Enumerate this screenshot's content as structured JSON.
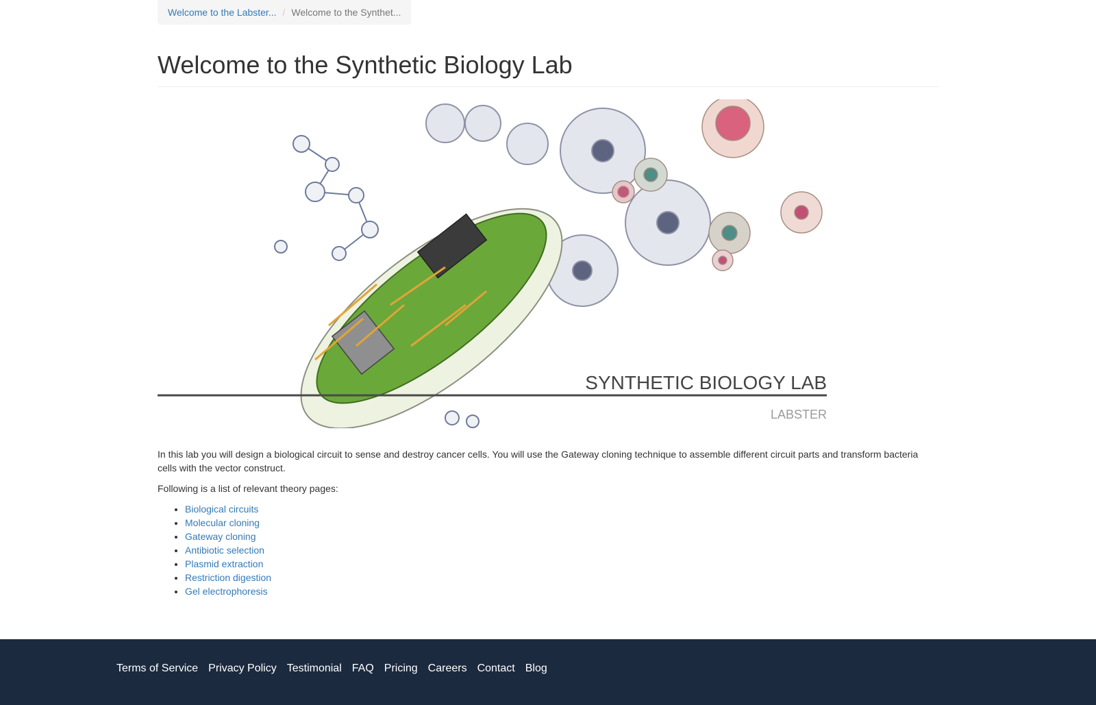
{
  "breadcrumb": {
    "items": [
      {
        "label": "Welcome to the Labster..."
      },
      {
        "label": "Welcome to the Synthet..."
      }
    ],
    "separator": "/"
  },
  "page": {
    "title": "Welcome to the Synthetic Biology Lab"
  },
  "hero": {
    "title": "SYNTHETIC BIOLOGY LAB",
    "subtitle": "LABSTER"
  },
  "content": {
    "description": "In this lab you will design a biological circuit to sense and destroy cancer cells. You will use the Gateway cloning technique to assemble different circuit parts and transform bacteria cells with the vector construct.",
    "intro": "Following is a list of relevant theory pages:",
    "theory_pages": [
      "Biological circuits",
      "Molecular cloning",
      "Gateway cloning",
      "Antibiotic selection",
      "Plasmid extraction",
      "Restriction digestion",
      "Gel electrophoresis"
    ]
  },
  "footer": {
    "links": [
      "Terms of Service",
      "Privacy Policy",
      "Testimonial",
      "FAQ",
      "Pricing",
      "Careers",
      "Contact",
      "Blog"
    ]
  },
  "colors": {
    "link": "#337ab7",
    "footer_bg": "#1b2a3e",
    "circuit_green": "#5a9e2f"
  }
}
